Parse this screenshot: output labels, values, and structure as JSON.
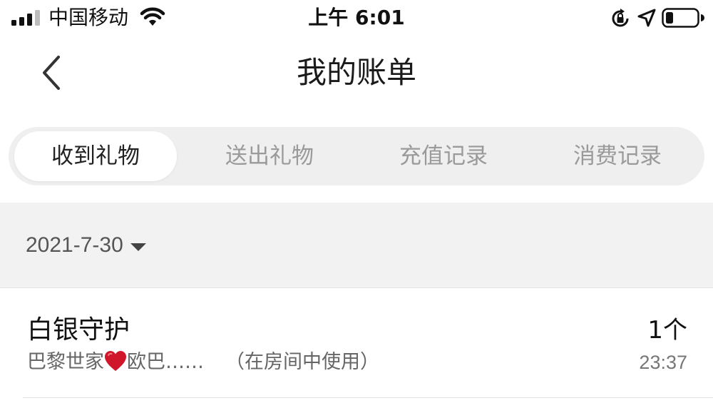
{
  "status_bar": {
    "carrier": "中国移动",
    "time": "上午 6:01"
  },
  "nav": {
    "title": "我的账单"
  },
  "tabs": [
    {
      "label": "收到礼物",
      "active": true
    },
    {
      "label": "送出礼物",
      "active": false
    },
    {
      "label": "充值记录",
      "active": false
    },
    {
      "label": "消费记录",
      "active": false
    }
  ],
  "date_filter": {
    "value": "2021-7-30"
  },
  "records": [
    {
      "gift": "白银守护",
      "quantity": "1个",
      "sender_prefix": "巴黎世家",
      "sender_suffix": "欧巴……",
      "usage": "（在房间中使用）",
      "time": "23:37"
    }
  ],
  "colors": {
    "tab_track": "#efefef",
    "date_bar_bg": "#f2f2f2",
    "heart": "#d0162b"
  },
  "icons": [
    "signal-icon",
    "wifi-icon",
    "rotation-lock-icon",
    "location-arrow-icon",
    "battery-icon",
    "back-chevron-icon",
    "dropdown-caret-icon",
    "heart-icon"
  ]
}
